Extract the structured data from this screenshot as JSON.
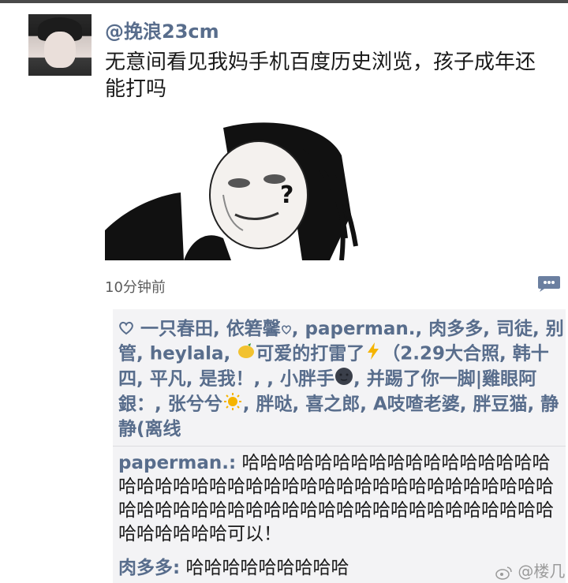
{
  "post": {
    "username": "@挽浪23cm",
    "text": "无意间看见我妈手机百度历史浏览，孩子成年还能打吗",
    "timestamp": "10分钟前",
    "meme_text": "?"
  },
  "likes": {
    "icon": "heart-outline-icon",
    "part1": "一只春田, 依箬馨",
    "part2": ", paperman., 肉多多, 司徒, 别管, heylala, ",
    "part3": "可爱的打雷了",
    "part4": "（2.29大合照, 韩十四, 平凡, 是我！, , 小胖手",
    "part5": ", 并踢了你一脚|雞眼阿銀：, 张兮兮",
    "part6": ", 胖哒, 喜之郎, A吱喳老婆, 胖豆猫, 静静(离线"
  },
  "comments": [
    {
      "author": "paperman.:",
      "text": " 哈哈哈哈哈哈哈哈哈哈哈哈哈哈哈哈哈哈哈哈哈哈哈哈哈哈哈哈哈哈哈哈哈哈哈哈哈哈哈哈哈哈哈哈哈哈哈哈哈哈哈哈哈哈哈哈哈哈哈哈哈哈哈哈哈哈哈哈哈哈哈可以！"
    },
    {
      "author": "肉多多:",
      "text": " 哈哈哈哈哈哈哈哈哈"
    }
  ],
  "watermark": "@楼几",
  "colors": {
    "name_blue": "#586d8c",
    "panel_bg": "#f3f3f5"
  }
}
